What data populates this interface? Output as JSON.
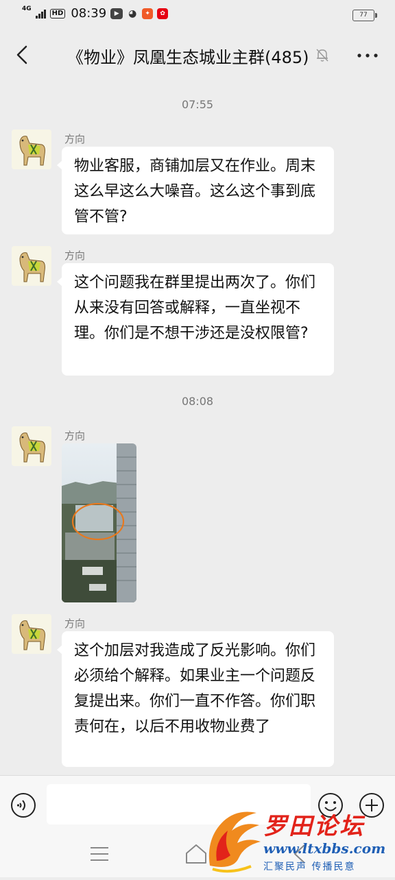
{
  "status_bar": {
    "network": "4G",
    "hd_label": "HD",
    "time": "08:39",
    "battery": "77",
    "icons": [
      "signal-icon",
      "hd-icon",
      "video-app-icon",
      "qq-icon",
      "red-app-icon",
      "app-icon"
    ]
  },
  "header": {
    "title": "《物业》凤凰生态城业主群(485)",
    "icons": [
      "back-icon",
      "mute-bell-icon",
      "more-icon"
    ]
  },
  "messages": [
    {
      "type": "time",
      "text": "07:55"
    },
    {
      "type": "text",
      "sender": "方向",
      "text": "物业客服，商铺加层又在作业。周末这么早这么大噪音。这么这个事到底管不管?"
    },
    {
      "type": "text",
      "sender": "方向",
      "text": "这个问题我在群里提出两次了。你们从来没有回答或解释，一直坐视不理。你们是不想干涉还是没权限管?"
    },
    {
      "type": "time",
      "text": "08:08"
    },
    {
      "type": "image",
      "sender": "方向"
    },
    {
      "type": "text",
      "sender": "方向",
      "text": "这个加层对我造成了反光影响。你们必须给个解释。如果业主一个问题反复提出来。你们一直不作答。你们职责何在，以后不用收物业费了"
    }
  ],
  "input_bar": {
    "value": "",
    "icons": [
      "voice-icon",
      "emoji-icon",
      "plus-icon"
    ]
  },
  "nav_bar": {
    "icons": [
      "menu-icon",
      "home-icon",
      "back-icon"
    ]
  },
  "watermark": {
    "title": "罗田论坛",
    "url": "www.ltxbbs.com",
    "slogan": "汇聚民声 传播民意"
  },
  "colors": {
    "background": "#ededed",
    "bubble": "#ffffff",
    "watermark_red": "#e2231a",
    "watermark_blue": "#1f5fb5"
  }
}
